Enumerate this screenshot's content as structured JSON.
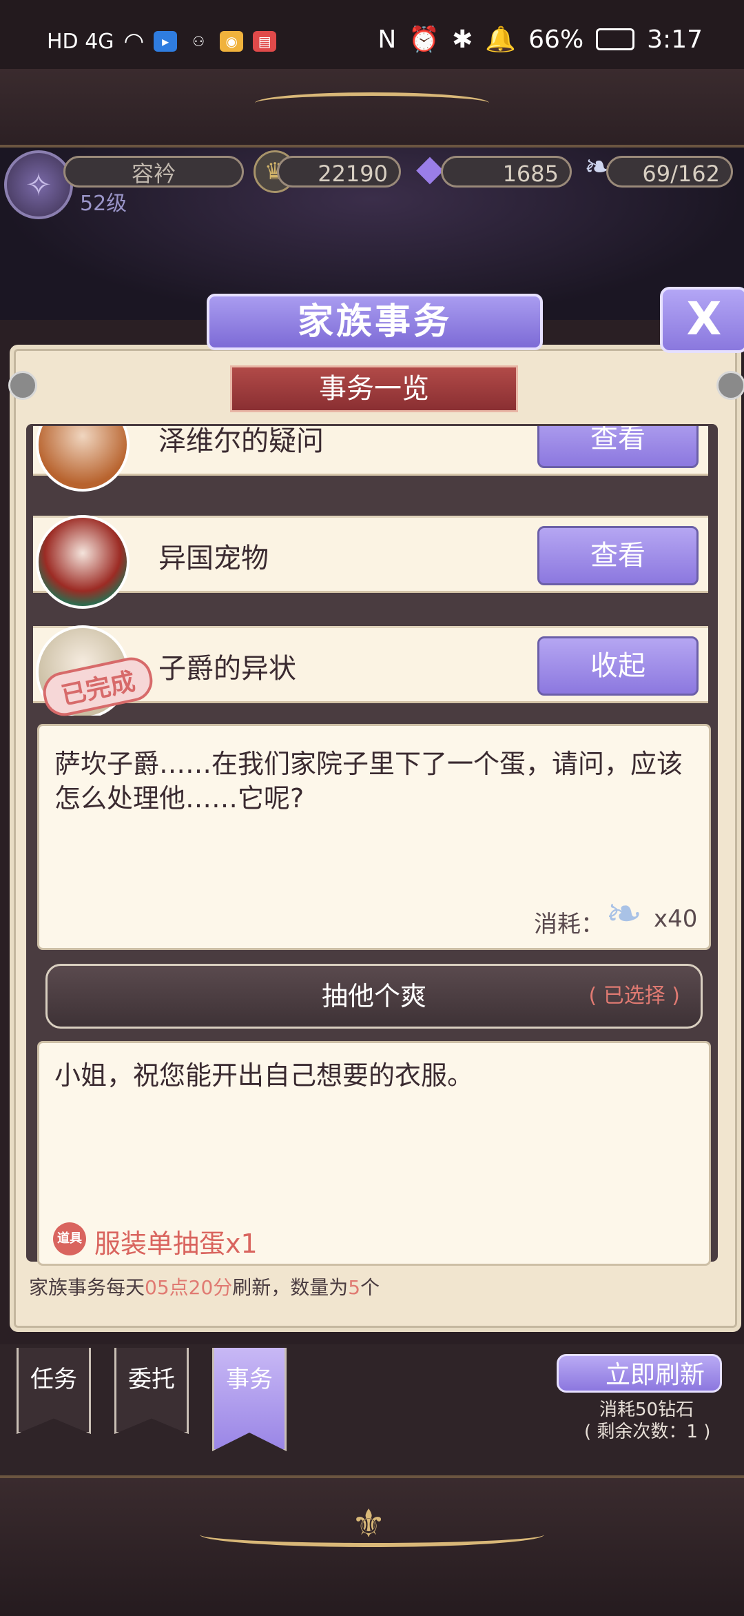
{
  "status_bar": {
    "network": "HD 4G",
    "battery": "66%",
    "time": "3:17"
  },
  "profile": {
    "name": "容衿",
    "level": "52级"
  },
  "resources": {
    "gold": "22190",
    "diamonds": "1685",
    "stamina": "69/162"
  },
  "dialog": {
    "title": "家族事务",
    "close_label": "X",
    "section_title": "事务一览"
  },
  "affairs": [
    {
      "title": "泽维尔的疑问",
      "button": "查看"
    },
    {
      "title": "异国宠物",
      "button": "查看"
    },
    {
      "title": "子爵的异状",
      "button": "收起",
      "badge": "已完成"
    }
  ],
  "detail": {
    "question": "萨坎子爵……在我们家院子里下了一个蛋，请问，应该怎么处理他……它呢?",
    "cost_label": "消耗：",
    "cost_amount": "x40",
    "choice_text": "抽他个爽",
    "choice_status": "( 已选择 )",
    "reply": "小姐，祝您能开出自己想要的衣服。",
    "reward_tag": "道具",
    "reward": "服装单抽蛋x1"
  },
  "footer_note": {
    "prefix": "家族事务每天",
    "time": "05点20分",
    "middle": "刷新，数量为",
    "count": "5",
    "suffix": "个"
  },
  "tabs": [
    {
      "label": "任务"
    },
    {
      "label": "委托"
    },
    {
      "label": "事务"
    }
  ],
  "refresh": {
    "label": "立即刷新",
    "cost": "消耗50钻石",
    "remaining": "( 剩余次数：1 )"
  },
  "colors": {
    "accent_purple": "#8c78df",
    "highlight_red": "#e07a72",
    "parchment": "#fdf7ea"
  }
}
